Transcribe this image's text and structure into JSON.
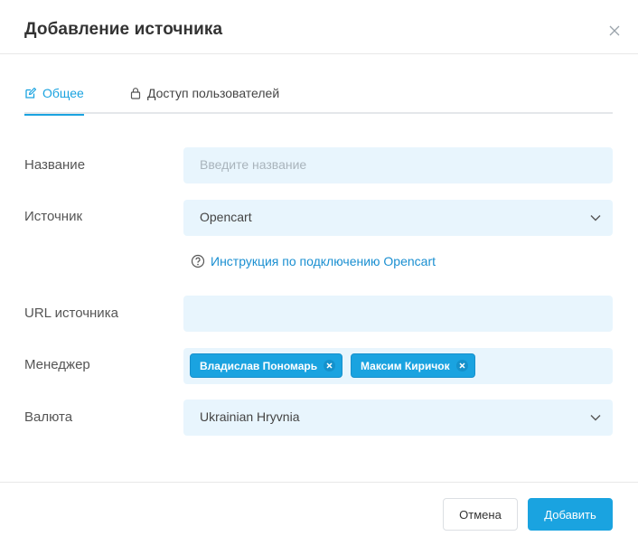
{
  "dialog": {
    "title": "Добавление источника"
  },
  "tabs": [
    {
      "label": "Общее",
      "icon": "edit-icon",
      "active": true
    },
    {
      "label": "Доступ пользователей",
      "icon": "lock-icon",
      "active": false
    }
  ],
  "form": {
    "name": {
      "label": "Название",
      "placeholder": "Введите название",
      "value": ""
    },
    "source": {
      "label": "Источник",
      "value": "Opencart"
    },
    "help_link": "Инструкция по подключению Opencart",
    "url": {
      "label": "URL источника",
      "value": ""
    },
    "manager": {
      "label": "Менеджер",
      "tags": [
        "Владислав Пономарь",
        "Максим Киричок"
      ]
    },
    "currency": {
      "label": "Валюта",
      "value": "Ukrainian Hryvnia"
    }
  },
  "footer": {
    "cancel_label": "Отмена",
    "add_label": "Добавить"
  },
  "colors": {
    "accent": "#1aa3e0",
    "field_bg": "#e8f5fd",
    "link": "#1a8fd1"
  }
}
